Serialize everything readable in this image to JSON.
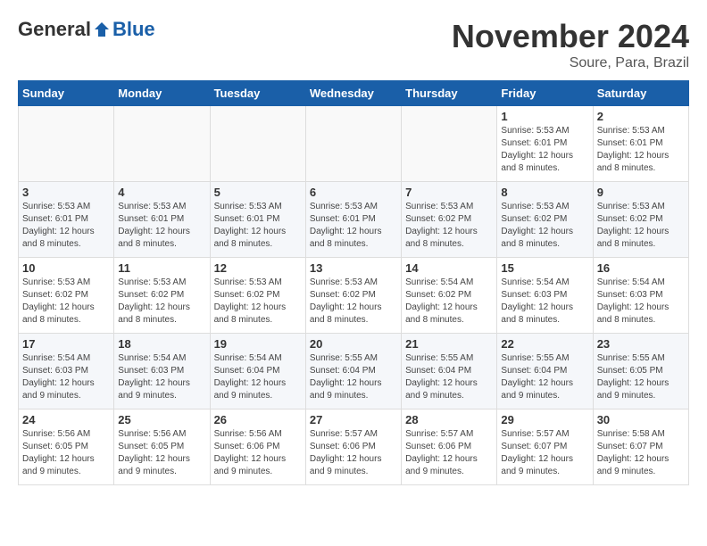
{
  "header": {
    "logo_general": "General",
    "logo_blue": "Blue",
    "month_title": "November 2024",
    "location": "Soure, Para, Brazil"
  },
  "weekdays": [
    "Sunday",
    "Monday",
    "Tuesday",
    "Wednesday",
    "Thursday",
    "Friday",
    "Saturday"
  ],
  "weeks": [
    [
      {
        "day": "",
        "info": ""
      },
      {
        "day": "",
        "info": ""
      },
      {
        "day": "",
        "info": ""
      },
      {
        "day": "",
        "info": ""
      },
      {
        "day": "",
        "info": ""
      },
      {
        "day": "1",
        "info": "Sunrise: 5:53 AM\nSunset: 6:01 PM\nDaylight: 12 hours and 8 minutes."
      },
      {
        "day": "2",
        "info": "Sunrise: 5:53 AM\nSunset: 6:01 PM\nDaylight: 12 hours and 8 minutes."
      }
    ],
    [
      {
        "day": "3",
        "info": "Sunrise: 5:53 AM\nSunset: 6:01 PM\nDaylight: 12 hours and 8 minutes."
      },
      {
        "day": "4",
        "info": "Sunrise: 5:53 AM\nSunset: 6:01 PM\nDaylight: 12 hours and 8 minutes."
      },
      {
        "day": "5",
        "info": "Sunrise: 5:53 AM\nSunset: 6:01 PM\nDaylight: 12 hours and 8 minutes."
      },
      {
        "day": "6",
        "info": "Sunrise: 5:53 AM\nSunset: 6:01 PM\nDaylight: 12 hours and 8 minutes."
      },
      {
        "day": "7",
        "info": "Sunrise: 5:53 AM\nSunset: 6:02 PM\nDaylight: 12 hours and 8 minutes."
      },
      {
        "day": "8",
        "info": "Sunrise: 5:53 AM\nSunset: 6:02 PM\nDaylight: 12 hours and 8 minutes."
      },
      {
        "day": "9",
        "info": "Sunrise: 5:53 AM\nSunset: 6:02 PM\nDaylight: 12 hours and 8 minutes."
      }
    ],
    [
      {
        "day": "10",
        "info": "Sunrise: 5:53 AM\nSunset: 6:02 PM\nDaylight: 12 hours and 8 minutes."
      },
      {
        "day": "11",
        "info": "Sunrise: 5:53 AM\nSunset: 6:02 PM\nDaylight: 12 hours and 8 minutes."
      },
      {
        "day": "12",
        "info": "Sunrise: 5:53 AM\nSunset: 6:02 PM\nDaylight: 12 hours and 8 minutes."
      },
      {
        "day": "13",
        "info": "Sunrise: 5:53 AM\nSunset: 6:02 PM\nDaylight: 12 hours and 8 minutes."
      },
      {
        "day": "14",
        "info": "Sunrise: 5:54 AM\nSunset: 6:02 PM\nDaylight: 12 hours and 8 minutes."
      },
      {
        "day": "15",
        "info": "Sunrise: 5:54 AM\nSunset: 6:03 PM\nDaylight: 12 hours and 8 minutes."
      },
      {
        "day": "16",
        "info": "Sunrise: 5:54 AM\nSunset: 6:03 PM\nDaylight: 12 hours and 8 minutes."
      }
    ],
    [
      {
        "day": "17",
        "info": "Sunrise: 5:54 AM\nSunset: 6:03 PM\nDaylight: 12 hours and 9 minutes."
      },
      {
        "day": "18",
        "info": "Sunrise: 5:54 AM\nSunset: 6:03 PM\nDaylight: 12 hours and 9 minutes."
      },
      {
        "day": "19",
        "info": "Sunrise: 5:54 AM\nSunset: 6:04 PM\nDaylight: 12 hours and 9 minutes."
      },
      {
        "day": "20",
        "info": "Sunrise: 5:55 AM\nSunset: 6:04 PM\nDaylight: 12 hours and 9 minutes."
      },
      {
        "day": "21",
        "info": "Sunrise: 5:55 AM\nSunset: 6:04 PM\nDaylight: 12 hours and 9 minutes."
      },
      {
        "day": "22",
        "info": "Sunrise: 5:55 AM\nSunset: 6:04 PM\nDaylight: 12 hours and 9 minutes."
      },
      {
        "day": "23",
        "info": "Sunrise: 5:55 AM\nSunset: 6:05 PM\nDaylight: 12 hours and 9 minutes."
      }
    ],
    [
      {
        "day": "24",
        "info": "Sunrise: 5:56 AM\nSunset: 6:05 PM\nDaylight: 12 hours and 9 minutes."
      },
      {
        "day": "25",
        "info": "Sunrise: 5:56 AM\nSunset: 6:05 PM\nDaylight: 12 hours and 9 minutes."
      },
      {
        "day": "26",
        "info": "Sunrise: 5:56 AM\nSunset: 6:06 PM\nDaylight: 12 hours and 9 minutes."
      },
      {
        "day": "27",
        "info": "Sunrise: 5:57 AM\nSunset: 6:06 PM\nDaylight: 12 hours and 9 minutes."
      },
      {
        "day": "28",
        "info": "Sunrise: 5:57 AM\nSunset: 6:06 PM\nDaylight: 12 hours and 9 minutes."
      },
      {
        "day": "29",
        "info": "Sunrise: 5:57 AM\nSunset: 6:07 PM\nDaylight: 12 hours and 9 minutes."
      },
      {
        "day": "30",
        "info": "Sunrise: 5:58 AM\nSunset: 6:07 PM\nDaylight: 12 hours and 9 minutes."
      }
    ]
  ]
}
